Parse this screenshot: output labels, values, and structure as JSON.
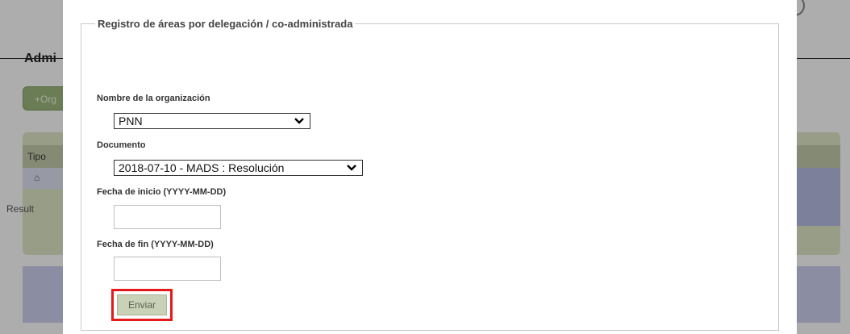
{
  "background": {
    "heading": "Admi",
    "add_button_label": "+Org",
    "table_header_first": "Tipo",
    "result_text": "Result"
  },
  "form": {
    "legend": "Registro de áreas por delegación / co-administrada",
    "organization": {
      "label": "Nombre de la organización",
      "value": "PNN"
    },
    "document": {
      "label": "Documento",
      "value": "2018-07-10 - MADS : Resolución"
    },
    "start_date": {
      "label": "Fecha de inicio (YYYY-MM-DD)",
      "value": ""
    },
    "end_date": {
      "label": "Fecha de fin (YYYY-MM-DD)",
      "value": ""
    },
    "submit_label": "Enviar"
  },
  "icons": {
    "home": "home-icon",
    "chevron": "chevron-down-icon"
  },
  "colors": {
    "highlight_border": "#e61919",
    "submit_background": "#c9d1b7"
  }
}
